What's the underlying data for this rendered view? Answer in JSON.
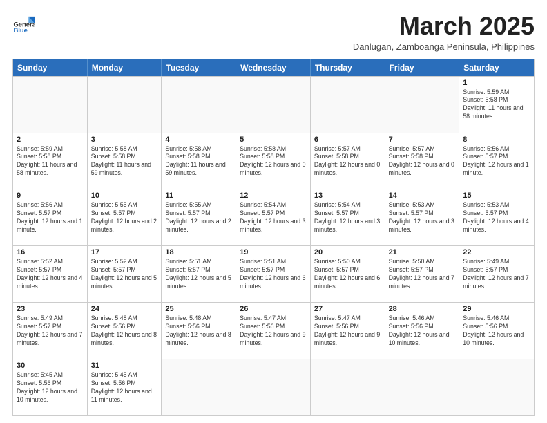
{
  "header": {
    "logo_general": "General",
    "logo_blue": "Blue",
    "month_title": "March 2025",
    "subtitle": "Danlugan, Zamboanga Peninsula, Philippines"
  },
  "days_of_week": [
    "Sunday",
    "Monday",
    "Tuesday",
    "Wednesday",
    "Thursday",
    "Friday",
    "Saturday"
  ],
  "rows": [
    [
      {
        "day": "",
        "info": ""
      },
      {
        "day": "",
        "info": ""
      },
      {
        "day": "",
        "info": ""
      },
      {
        "day": "",
        "info": ""
      },
      {
        "day": "",
        "info": ""
      },
      {
        "day": "",
        "info": ""
      },
      {
        "day": "1",
        "info": "Sunrise: 5:59 AM\nSunset: 5:58 PM\nDaylight: 11 hours and 58 minutes."
      }
    ],
    [
      {
        "day": "2",
        "info": "Sunrise: 5:59 AM\nSunset: 5:58 PM\nDaylight: 11 hours and 58 minutes."
      },
      {
        "day": "3",
        "info": "Sunrise: 5:58 AM\nSunset: 5:58 PM\nDaylight: 11 hours and 59 minutes."
      },
      {
        "day": "4",
        "info": "Sunrise: 5:58 AM\nSunset: 5:58 PM\nDaylight: 11 hours and 59 minutes."
      },
      {
        "day": "5",
        "info": "Sunrise: 5:58 AM\nSunset: 5:58 PM\nDaylight: 12 hours and 0 minutes."
      },
      {
        "day": "6",
        "info": "Sunrise: 5:57 AM\nSunset: 5:58 PM\nDaylight: 12 hours and 0 minutes."
      },
      {
        "day": "7",
        "info": "Sunrise: 5:57 AM\nSunset: 5:58 PM\nDaylight: 12 hours and 0 minutes."
      },
      {
        "day": "8",
        "info": "Sunrise: 5:56 AM\nSunset: 5:57 PM\nDaylight: 12 hours and 1 minute."
      }
    ],
    [
      {
        "day": "9",
        "info": "Sunrise: 5:56 AM\nSunset: 5:57 PM\nDaylight: 12 hours and 1 minute."
      },
      {
        "day": "10",
        "info": "Sunrise: 5:55 AM\nSunset: 5:57 PM\nDaylight: 12 hours and 2 minutes."
      },
      {
        "day": "11",
        "info": "Sunrise: 5:55 AM\nSunset: 5:57 PM\nDaylight: 12 hours and 2 minutes."
      },
      {
        "day": "12",
        "info": "Sunrise: 5:54 AM\nSunset: 5:57 PM\nDaylight: 12 hours and 3 minutes."
      },
      {
        "day": "13",
        "info": "Sunrise: 5:54 AM\nSunset: 5:57 PM\nDaylight: 12 hours and 3 minutes."
      },
      {
        "day": "14",
        "info": "Sunrise: 5:53 AM\nSunset: 5:57 PM\nDaylight: 12 hours and 3 minutes."
      },
      {
        "day": "15",
        "info": "Sunrise: 5:53 AM\nSunset: 5:57 PM\nDaylight: 12 hours and 4 minutes."
      }
    ],
    [
      {
        "day": "16",
        "info": "Sunrise: 5:52 AM\nSunset: 5:57 PM\nDaylight: 12 hours and 4 minutes."
      },
      {
        "day": "17",
        "info": "Sunrise: 5:52 AM\nSunset: 5:57 PM\nDaylight: 12 hours and 5 minutes."
      },
      {
        "day": "18",
        "info": "Sunrise: 5:51 AM\nSunset: 5:57 PM\nDaylight: 12 hours and 5 minutes."
      },
      {
        "day": "19",
        "info": "Sunrise: 5:51 AM\nSunset: 5:57 PM\nDaylight: 12 hours and 6 minutes."
      },
      {
        "day": "20",
        "info": "Sunrise: 5:50 AM\nSunset: 5:57 PM\nDaylight: 12 hours and 6 minutes."
      },
      {
        "day": "21",
        "info": "Sunrise: 5:50 AM\nSunset: 5:57 PM\nDaylight: 12 hours and 7 minutes."
      },
      {
        "day": "22",
        "info": "Sunrise: 5:49 AM\nSunset: 5:57 PM\nDaylight: 12 hours and 7 minutes."
      }
    ],
    [
      {
        "day": "23",
        "info": "Sunrise: 5:49 AM\nSunset: 5:57 PM\nDaylight: 12 hours and 7 minutes."
      },
      {
        "day": "24",
        "info": "Sunrise: 5:48 AM\nSunset: 5:56 PM\nDaylight: 12 hours and 8 minutes."
      },
      {
        "day": "25",
        "info": "Sunrise: 5:48 AM\nSunset: 5:56 PM\nDaylight: 12 hours and 8 minutes."
      },
      {
        "day": "26",
        "info": "Sunrise: 5:47 AM\nSunset: 5:56 PM\nDaylight: 12 hours and 9 minutes."
      },
      {
        "day": "27",
        "info": "Sunrise: 5:47 AM\nSunset: 5:56 PM\nDaylight: 12 hours and 9 minutes."
      },
      {
        "day": "28",
        "info": "Sunrise: 5:46 AM\nSunset: 5:56 PM\nDaylight: 12 hours and 10 minutes."
      },
      {
        "day": "29",
        "info": "Sunrise: 5:46 AM\nSunset: 5:56 PM\nDaylight: 12 hours and 10 minutes."
      }
    ],
    [
      {
        "day": "30",
        "info": "Sunrise: 5:45 AM\nSunset: 5:56 PM\nDaylight: 12 hours and 10 minutes."
      },
      {
        "day": "31",
        "info": "Sunrise: 5:45 AM\nSunset: 5:56 PM\nDaylight: 12 hours and 11 minutes."
      },
      {
        "day": "",
        "info": ""
      },
      {
        "day": "",
        "info": ""
      },
      {
        "day": "",
        "info": ""
      },
      {
        "day": "",
        "info": ""
      },
      {
        "day": "",
        "info": ""
      }
    ]
  ]
}
